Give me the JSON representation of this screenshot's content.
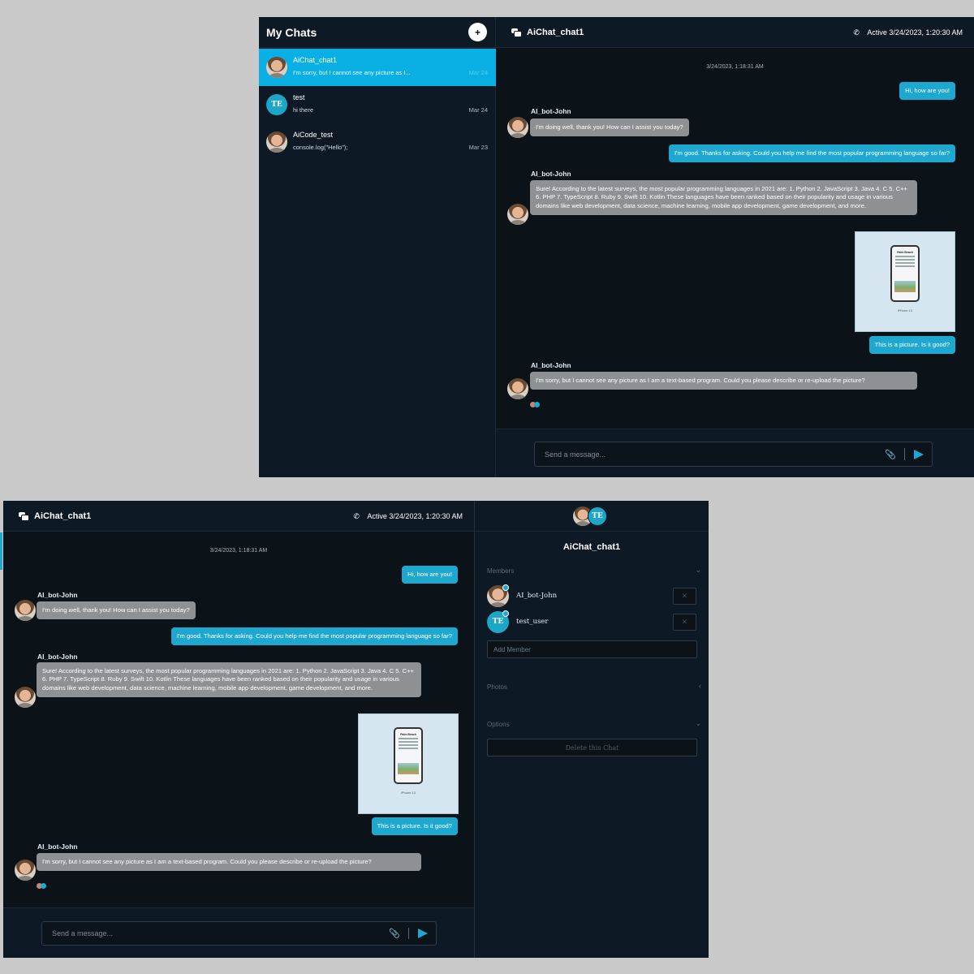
{
  "sidebar": {
    "title": "My Chats",
    "new_chat_icon": "+",
    "chats": [
      {
        "name": "AiChat_chat1",
        "preview": "I'm sorry, but I cannot see any picture as I...",
        "date": "Mar 24",
        "avatar": "photo"
      },
      {
        "name": "test",
        "preview": "hi there",
        "date": "Mar 24",
        "avatar": "TE"
      },
      {
        "name": "AiCode_test",
        "preview": "console.log(\"Hello\");",
        "date": "Mar 23",
        "avatar": "photo"
      }
    ]
  },
  "chat": {
    "title": "AiChat_chat1",
    "status": "Active 3/24/2023, 1:20:30 AM",
    "date_line": "3/24/2023, 1:18:31 AM",
    "messages": [
      {
        "sender": "user",
        "text": "Hi, how are you!"
      },
      {
        "sender": "AI_bot-John",
        "text": "I'm doing well, thank you! How can I assist you today?"
      },
      {
        "sender": "user",
        "text": "I'm good. Thanks for asking. Could you help me find the most popular programming language so far?"
      },
      {
        "sender": "AI_bot-John",
        "text": "Sure! According to the latest surveys, the most popular programming languages in 2021 are: 1. Python 2. JavaScript 3. Java 4. C 5. C++ 6. PHP 7. TypeScript 8. Ruby 9. Swift 10. Kotlin These languages have been ranked based on their popularity and usage in various domains like web development, data science, machine learning, mobile app development, game development, and more."
      },
      {
        "sender": "user",
        "type": "image",
        "img_title": "Palm Beach",
        "img_caption": "iPhone 13"
      },
      {
        "sender": "user",
        "text": "This is a picture. Is it good?"
      },
      {
        "sender": "AI_bot-John",
        "text": "I'm sorry, but I cannot see any picture as I am a text-based program. Could you please describe or re-upload the picture?"
      }
    ],
    "input_placeholder": "Send a message...",
    "attach_icon": "paperclip-icon",
    "send_icon": "send-arrow-icon"
  },
  "info_panel": {
    "group_name": "AiChat_chat1",
    "members_label": "Members",
    "members": [
      {
        "name": "AI_bot-John",
        "avatar": "photo",
        "remove": "✕"
      },
      {
        "name": "test_user",
        "avatar": "TE",
        "remove": "✕"
      }
    ],
    "add_member_placeholder": "Add Member",
    "photos_label": "Photos",
    "options_label": "Options",
    "delete_label": "Delete this Chat",
    "avatar_initials": "TE"
  },
  "colors": {
    "accent": "#1fa8cf",
    "active_row": "#0ab0e4",
    "bot_bubble": "#8e9194",
    "panel": "#0d1a26",
    "chat_bg": "#0b1218"
  }
}
